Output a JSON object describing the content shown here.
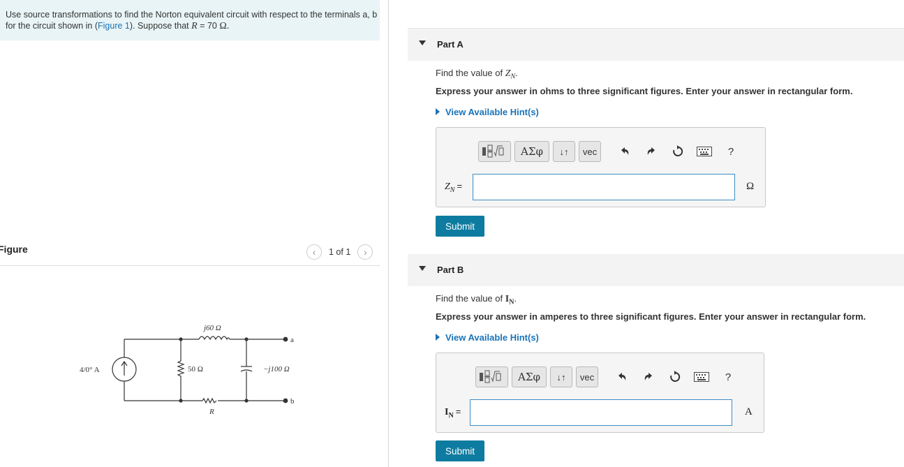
{
  "problem": {
    "text_1": "Use source transformations to find the Norton equivalent circuit with respect to the terminals a, b for the circuit shown in (",
    "figure_link": "Figure 1",
    "text_2": "). Suppose that",
    "var": "R",
    "text_3": "= 70",
    "unit": "Ω."
  },
  "figure": {
    "label": "Figure",
    "counter": "1 of 1",
    "circuit": {
      "source": "4/0° A",
      "inductor": "j60 Ω",
      "resistor_50": "50 Ω",
      "capacitor": "−j100 Ω",
      "resistor_r": "R",
      "terminal_a": "a",
      "terminal_b": "b"
    }
  },
  "parts": [
    {
      "title": "Part A",
      "question_prefix": "Find the value of",
      "question_var": "Z",
      "question_sub": "N",
      "instructions": "Express your answer in ohms to three significant figures. Enter your answer in rectangular form.",
      "hint": "View Available Hint(s)",
      "answer_label": "Z",
      "answer_sub": "N",
      "answer_eq": "=",
      "answer_value": "",
      "unit": "Ω",
      "submit": "Submit"
    },
    {
      "title": "Part B",
      "question_prefix": "Find the value of",
      "question_var": "I",
      "question_sub": "N",
      "instructions": "Express your answer in amperes to three significant figures. Enter your answer in rectangular form.",
      "hint": "View Available Hint(s)",
      "answer_label": "I",
      "answer_sub": "N",
      "answer_eq": "=",
      "answer_value": "",
      "unit": "A",
      "submit": "Submit"
    }
  ],
  "toolbar": {
    "greek_label": "ΑΣφ",
    "arrows_label": "↓↑",
    "vec_label": "vec",
    "help_label": "?"
  },
  "icons": [
    "templates-icon",
    "undo-icon",
    "redo-icon",
    "reset-icon",
    "keyboard-icon",
    "help-icon"
  ]
}
